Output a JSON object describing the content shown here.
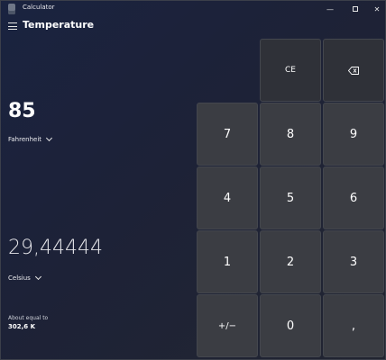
{
  "window": {
    "title": "Calculator",
    "controls": {
      "minimize": "—",
      "close": "✕"
    }
  },
  "header": {
    "title": "Temperature"
  },
  "converter": {
    "from": {
      "value": "85",
      "unit": "Fahrenheit"
    },
    "to": {
      "value": "29,44444",
      "unit": "Celsius"
    },
    "about": {
      "label": "About equal to",
      "value": "302,6 K"
    }
  },
  "keypad": {
    "ce": "CE",
    "k7": "7",
    "k8": "8",
    "k9": "9",
    "k4": "4",
    "k5": "5",
    "k6": "6",
    "k1": "1",
    "k2": "2",
    "k3": "3",
    "negate": "+/−",
    "k0": "0",
    "decimal": ","
  },
  "icons": {
    "app": "calculator-icon",
    "menu": "hamburger-icon",
    "backspace": "backspace-icon",
    "dropdown": "chevron-down-icon"
  }
}
